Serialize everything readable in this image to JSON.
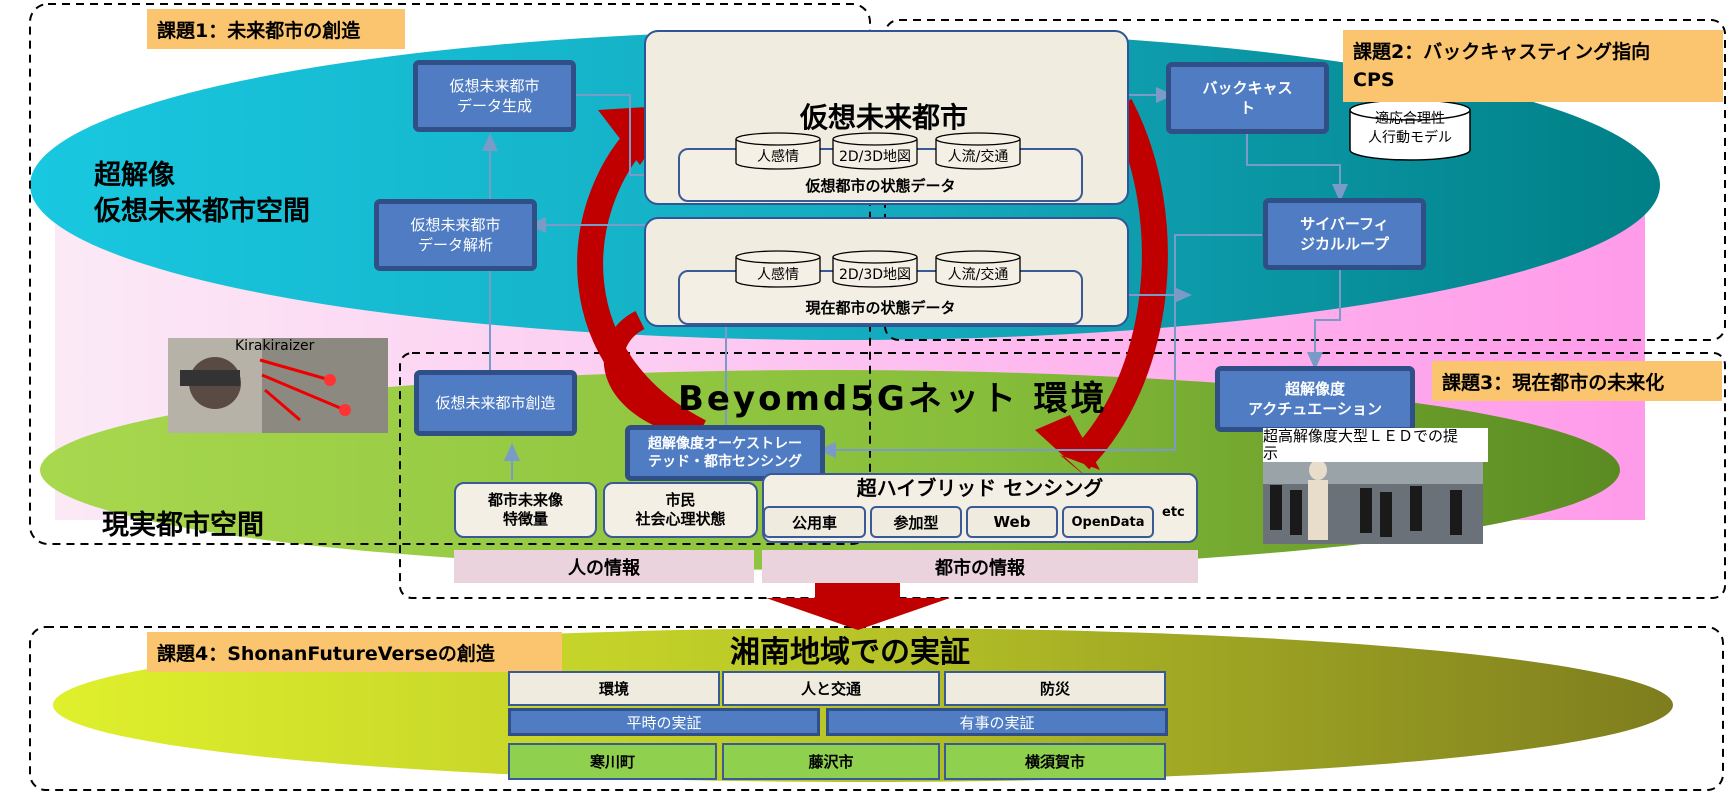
{
  "tasks": {
    "task1": "課題1：未来都市の創造",
    "task2": "課題2：バックキャスティング指向\nCPS",
    "task3": "課題3：現在都市の未来化",
    "task4": "課題4：ShonanFutureVerseの創造"
  },
  "spaces": {
    "virtual": "超解像\n仮想未来都市空間",
    "real": "現実都市空間",
    "network": "Beyomd5Gネット 環境"
  },
  "virtual_city": {
    "title": "仮想未来都市",
    "state_label": "仮想都市の状態データ",
    "dbs": [
      "人感情",
      "2D/3D地図",
      "人流/交通"
    ]
  },
  "current_city": {
    "state_label": "現在都市の状態データ",
    "dbs": [
      "人感情",
      "2D/3D地図",
      "人流/交通"
    ]
  },
  "boxes": {
    "data_gen": "仮想未来都市\nデータ生成",
    "data_analysis": "仮想未来都市\nデータ解析",
    "create": "仮想未来都市創造",
    "backcast": "バックキャス\nト",
    "cps_loop": "サイバーフィ\nジカルループ",
    "actuation": "超解像度\nアクチュエーション",
    "orchestrated": "超解像度オーケストレー\nテッド・都市センシング"
  },
  "model_db": "適応合理性\n人行動モデル",
  "kirakiraizer": "Kirakiraizer",
  "led_caption": "超高解像度大型ＬＥＤでの提\n示",
  "sensing": {
    "features": "都市未来像\n特徴量",
    "citizens": "市民\n社会心理状態",
    "hybrid_title": "超ハイブリッド センシング",
    "items": [
      "公用車",
      "参加型",
      "Web",
      "OpenData"
    ],
    "etc": "etc"
  },
  "info": {
    "people": "人の情報",
    "city": "都市の情報"
  },
  "shonan": {
    "title": "湘南地域での実証",
    "themes": [
      "環境",
      "人と交通",
      "防災"
    ],
    "modes": [
      "平時の実証",
      "有事の実証"
    ],
    "towns": [
      "寒川町",
      "藤沢市",
      "横須賀市"
    ]
  },
  "colors": {
    "cyan": "#00c0d8",
    "teal": "#008a90",
    "pink": "#ffc0ee",
    "green": "#8fc83a",
    "red_arrow": "#c00000",
    "box_blue": "#4f7cc2",
    "title_orange": "#fbc46e"
  }
}
